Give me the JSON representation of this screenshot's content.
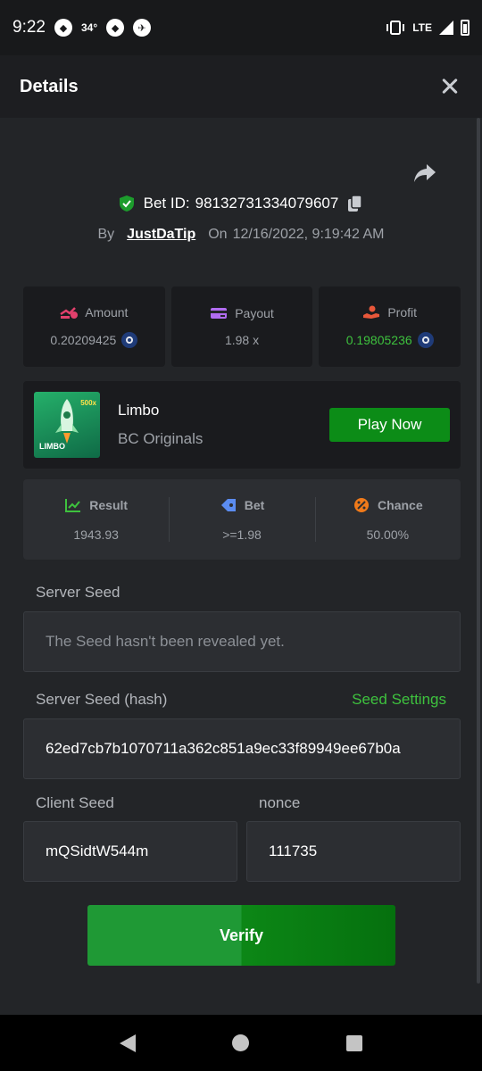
{
  "status_bar": {
    "time": "9:22",
    "temp": "34°",
    "network": "LTE"
  },
  "header": {
    "title": "Details"
  },
  "bet": {
    "id_label": "Bet ID:",
    "id": "98132731334079607",
    "by_label": "By",
    "user": "JustDaTip",
    "on_label": "On",
    "date": "12/16/2022, 9:19:42 AM"
  },
  "stats": [
    {
      "label": "Amount",
      "value": "0.20209425",
      "icon": "amount-icon",
      "color": "#e2406c"
    },
    {
      "label": "Payout",
      "value": "1.98 x",
      "icon": "card-icon",
      "color": "#b16cf0"
    },
    {
      "label": "Profit",
      "value": "0.19805236",
      "icon": "hand-coin-icon",
      "color": "#e8573a",
      "value_color": "#3ec23e"
    }
  ],
  "game": {
    "name": "Limbo",
    "provider": "BC Originals",
    "thumb_text": "LIMBO",
    "thumb_badge": "500x",
    "play_label": "Play Now"
  },
  "result": [
    {
      "label": "Result",
      "value": "1943.93",
      "icon": "chart-up-icon",
      "color": "#3ec23e"
    },
    {
      "label": "Bet",
      "value": ">=1.98",
      "icon": "ticket-icon",
      "color": "#5b8cf0"
    },
    {
      "label": "Chance",
      "value": "50.00%",
      "icon": "percent-icon",
      "color": "#f07a1a"
    }
  ],
  "server_seed": {
    "label": "Server Seed",
    "placeholder": "The Seed hasn't been revealed yet."
  },
  "server_seed_hash": {
    "label": "Server Seed (hash)",
    "value": "62ed7cb7b1070711a362c851a9ec33f89949ee67b0a",
    "settings_label": "Seed Settings"
  },
  "client_seed": {
    "label": "Client Seed",
    "value": "mQSidtW544m"
  },
  "nonce": {
    "label": "nonce",
    "value": "111735"
  },
  "verify_label": "Verify"
}
